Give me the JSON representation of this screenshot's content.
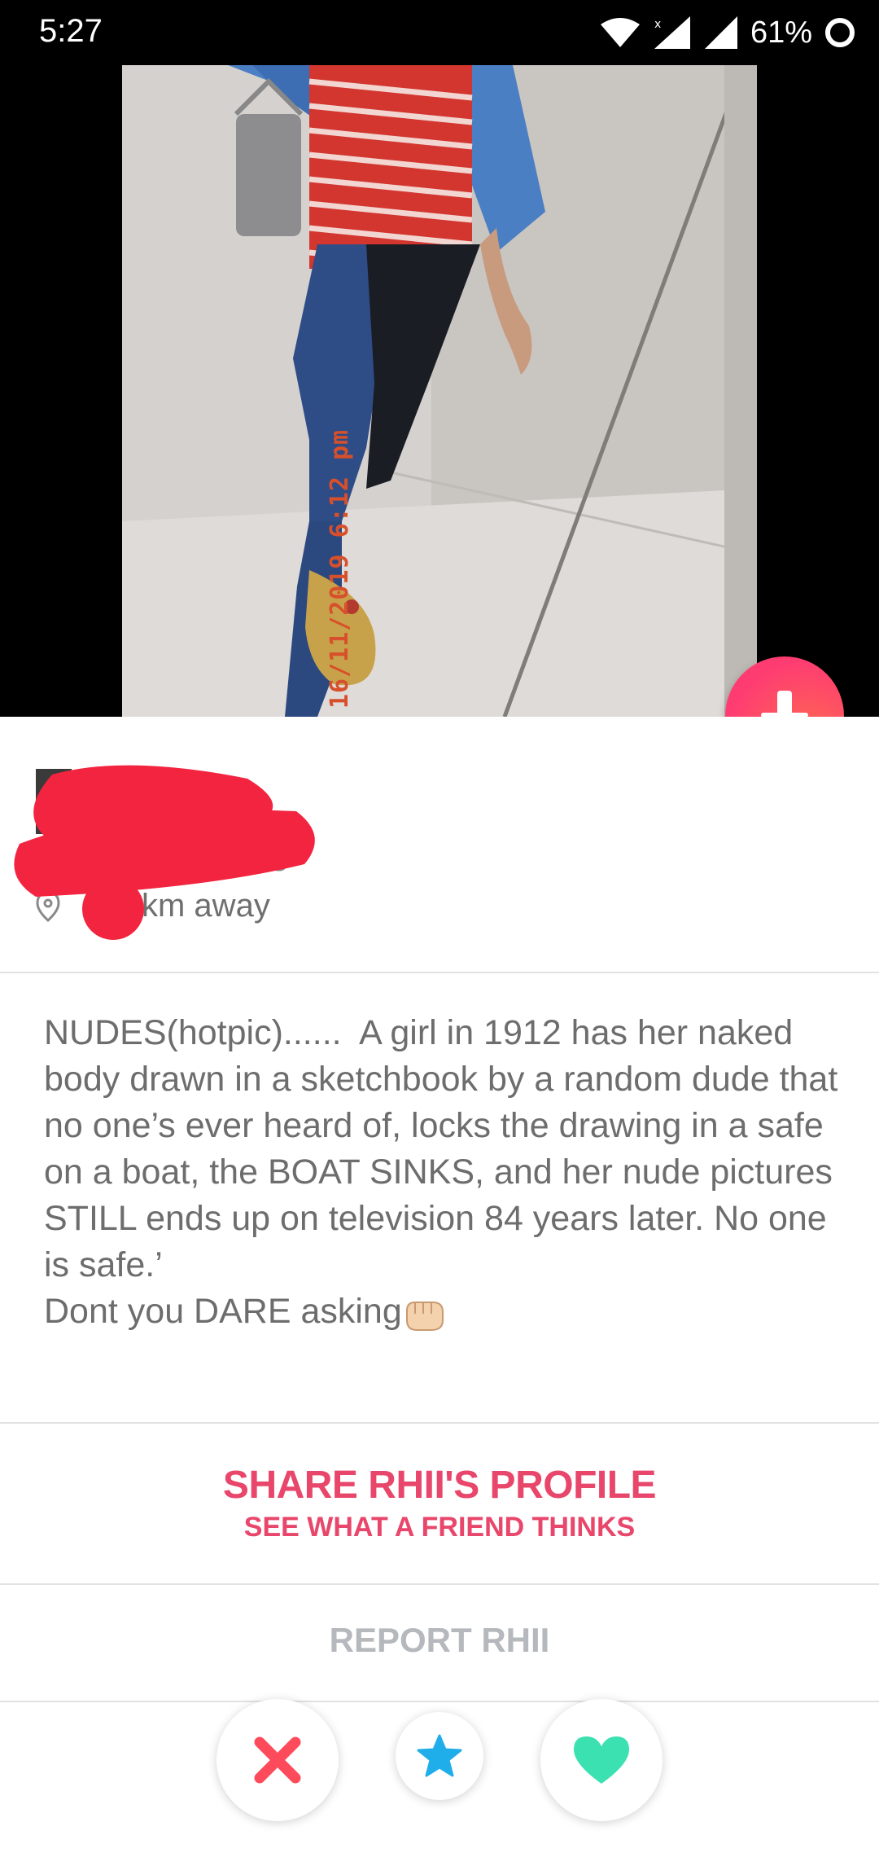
{
  "status_bar": {
    "time": "5:27",
    "battery": "61%"
  },
  "photo": {
    "date_stamp": "16/11/2019 6:12 pm"
  },
  "profile": {
    "distance": "km away"
  },
  "bio": {
    "text": "NUDES(hotpic)......  A girl in 1912 has her naked body drawn in a sketchbook by a random dude that no one’s ever heard of, locks the drawing in a safe on a boat, the BOAT SINKS, and her nude pictures STILL ends up on television 84 years later. No one is safe.’\nDont you DARE asking"
  },
  "share": {
    "title": "SHARE RHII'S PROFILE",
    "subtitle": "SEE WHAT A FRIEND THINKS"
  },
  "report": {
    "label": "REPORT RHII"
  },
  "actions": {
    "nope": "close-icon",
    "super_like": "star-icon",
    "like": "heart-icon"
  },
  "colors": {
    "brand": "#fe3c72",
    "share_text": "#e8476b",
    "nope": "#fd4b5b",
    "super_like": "#20aeeb",
    "like": "#3be1b1"
  }
}
